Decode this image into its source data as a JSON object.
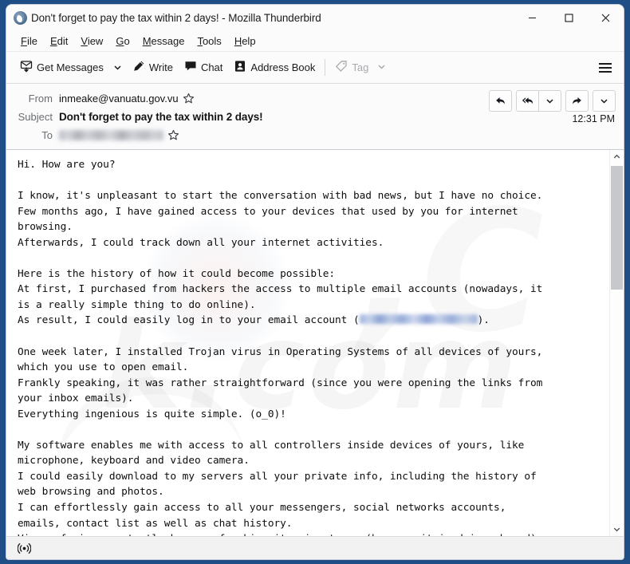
{
  "window": {
    "title": "Don't forget to pay the tax within 2 days! - Mozilla Thunderbird",
    "app_icon": "thunderbird-icon",
    "border_color": "#1f4e87",
    "controls": {
      "minimize": "minimize-icon",
      "maximize": "maximize-icon",
      "close": "close-icon"
    }
  },
  "menubar": {
    "items": [
      {
        "pre": "",
        "key": "F",
        "post": "ile"
      },
      {
        "pre": "",
        "key": "E",
        "post": "dit"
      },
      {
        "pre": "",
        "key": "V",
        "post": "iew"
      },
      {
        "pre": "",
        "key": "G",
        "post": "o"
      },
      {
        "pre": "",
        "key": "M",
        "post": "essage"
      },
      {
        "pre": "",
        "key": "T",
        "post": "ools"
      },
      {
        "pre": "",
        "key": "H",
        "post": "elp"
      }
    ]
  },
  "toolbar": {
    "get_messages": "Get Messages",
    "write": "Write",
    "chat": "Chat",
    "address_book": "Address Book",
    "tag": "Tag",
    "hamburger": "app-menu-icon"
  },
  "message": {
    "from_label": "From",
    "from_value": "inmeake@vanuatu.gov.vu",
    "subject_label": "Subject",
    "subject_value": "Don't forget to pay the tax within 2 days!",
    "to_label": "To",
    "to_value": "",
    "to_redacted": true,
    "timestamp": "12:31 PM",
    "actions": {
      "reply": "reply-icon",
      "reply_all": "reply-all-icon",
      "reply_all_menu": "chevron-down-icon",
      "forward": "forward-icon",
      "more_menu": "chevron-down-icon"
    }
  },
  "body": {
    "part1": "Hi. How are you?\n\nI know, it's unpleasant to start the conversation with bad news, but I have no choice.\nFew months ago, I have gained access to your devices that used by you for internet\nbrowsing.\nAfterwards, I could track down all your internet activities.\n\nHere is the history of how it could become possible:\nAt first, I purchased from hackers the access to multiple email accounts (nowadays, it\nis a really simple thing to do online).\nAs result, I could easily log in to your email account (",
    "redacted_email": "",
    "part2": ").\n\nOne week later, I installed Trojan virus in Operating Systems of all devices of yours,\nwhich you use to open email.\nFrankly speaking, it was rather straightforward (since you were opening the links from\nyour inbox emails).\nEverything ingenious is quite simple. (o_0)!\n\nMy software enables me with access to all controllers inside devices of yours, like\nmicrophone, keyboard and video camera.\nI could easily download to my servers all your private info, including the history of\nweb browsing and photos.\nI can effortlessly gain access to all your messengers, social networks accounts,\nemails, contact list as well as chat history.\nVirus of mine constantly keeps refreshing its signatures (because it is driver-based),\nand as result remains unnoticed by your antivirus."
  },
  "scrollbar": {
    "up": "chevron-up-icon",
    "down": "chevron-down-icon"
  },
  "statusbar": {
    "icon": "broadcast-icon"
  }
}
